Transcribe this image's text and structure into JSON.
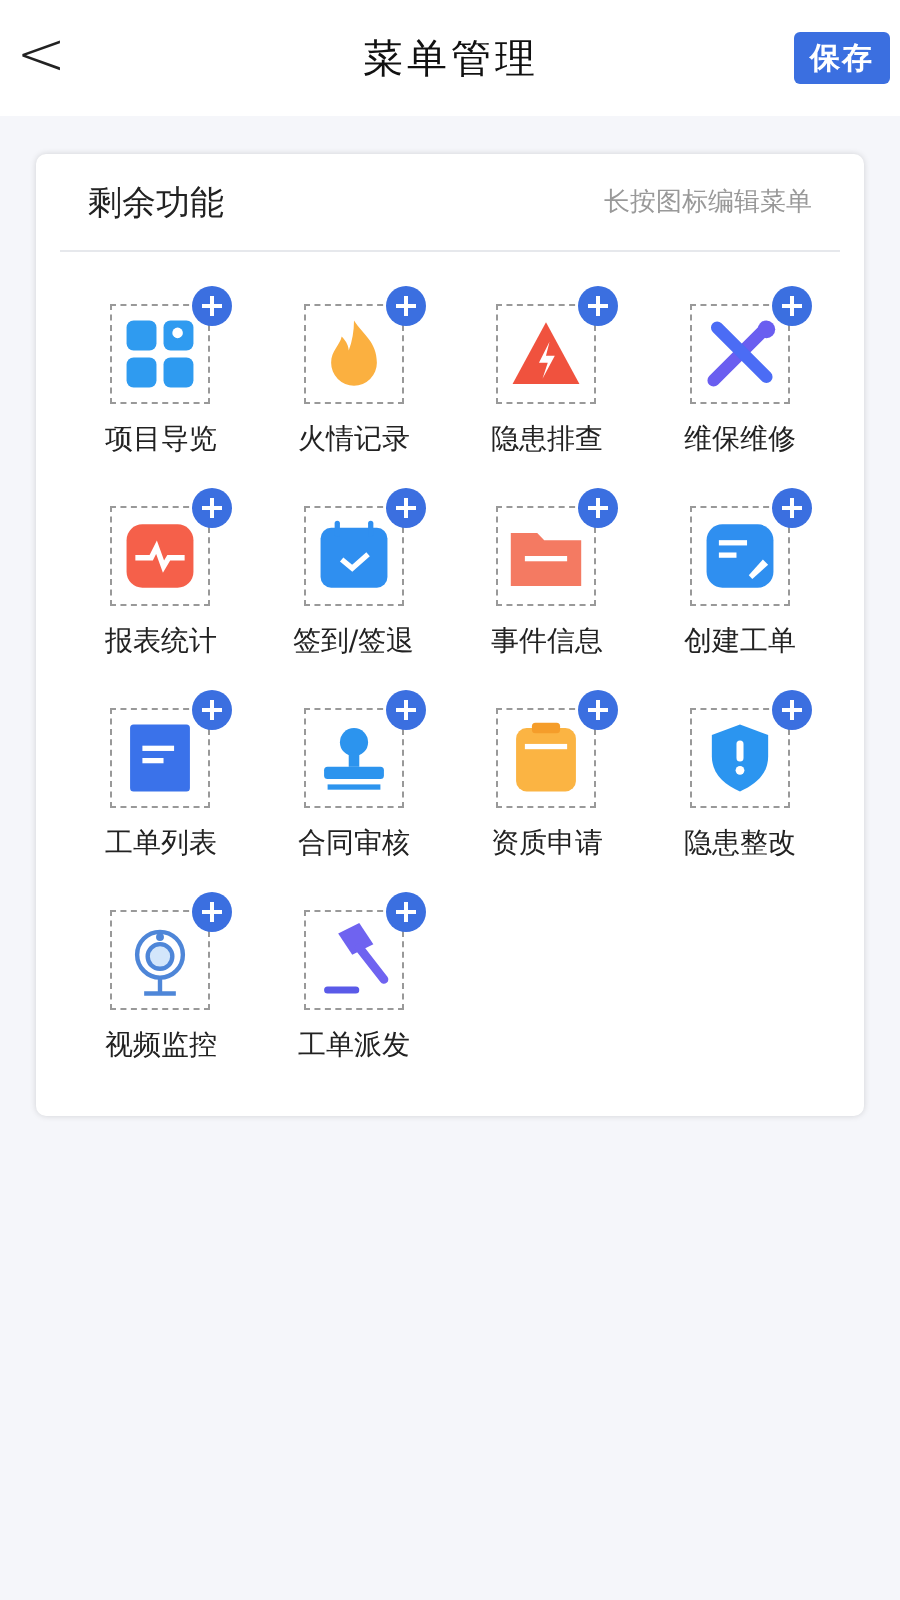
{
  "header": {
    "back": "<",
    "title": "菜单管理",
    "save": "保存"
  },
  "panel": {
    "title": "剩余功能",
    "hint": "长按图标编辑菜单",
    "items": [
      {
        "label": "项目导览",
        "kind": "map"
      },
      {
        "label": "火情记录",
        "kind": "flame"
      },
      {
        "label": "隐患排查",
        "kind": "warning"
      },
      {
        "label": "维保维修",
        "kind": "tools"
      },
      {
        "label": "报表统计",
        "kind": "pulse"
      },
      {
        "label": "签到/签退",
        "kind": "calendar"
      },
      {
        "label": "事件信息",
        "kind": "folder"
      },
      {
        "label": "创建工单",
        "kind": "note"
      },
      {
        "label": "工单列表",
        "kind": "doc"
      },
      {
        "label": "合同审核",
        "kind": "stamp"
      },
      {
        "label": "资质申请",
        "kind": "clipboard"
      },
      {
        "label": "隐患整改",
        "kind": "shield"
      },
      {
        "label": "视频监控",
        "kind": "camera"
      },
      {
        "label": "工单派发",
        "kind": "gavel"
      }
    ]
  }
}
